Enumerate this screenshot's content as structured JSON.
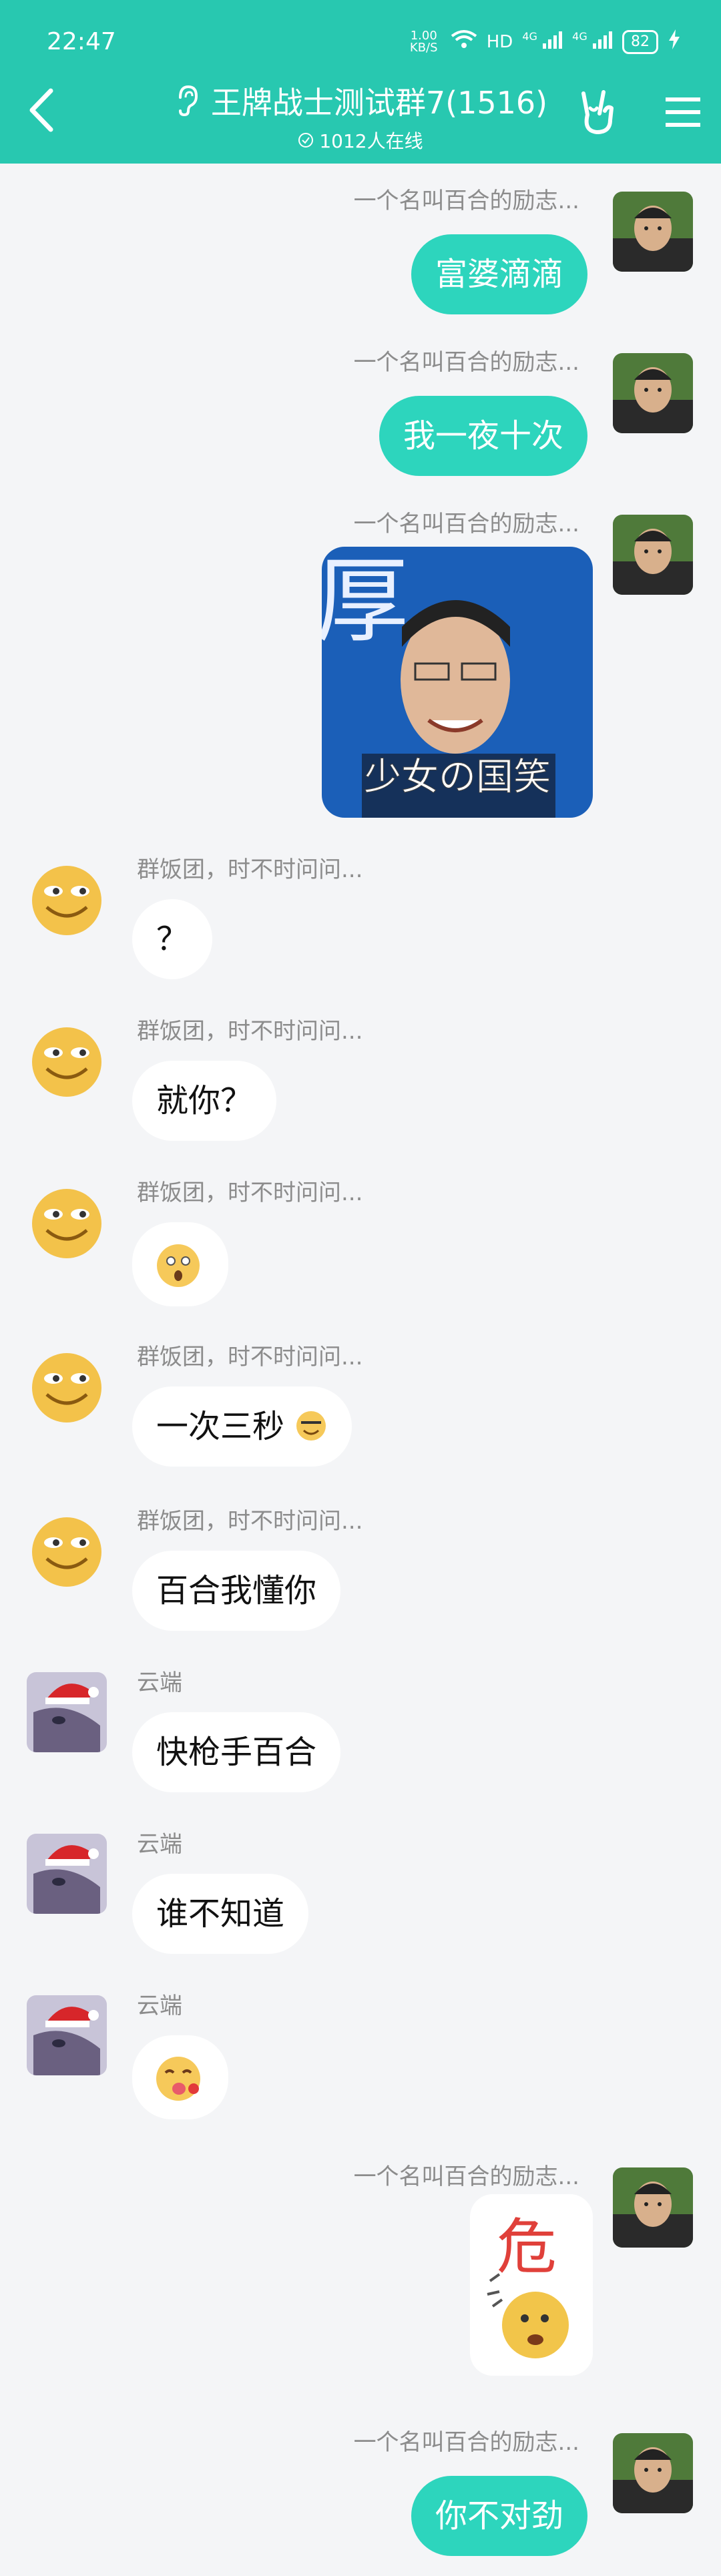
{
  "status_bar": {
    "time": "22:47",
    "network_speed": "1.00 KB/S",
    "hd": "HD",
    "signal1": "4G",
    "signal2": "4G",
    "battery": "82"
  },
  "header": {
    "title": "王牌战士测试群7(1516)",
    "online": "1012人在线"
  },
  "messages": [
    {
      "sender": "一个名叫百合的励志...",
      "side": "right",
      "text": "富婆滴滴"
    },
    {
      "sender": "一个名叫百合的励志...",
      "side": "right",
      "text": "我一夜十次"
    },
    {
      "sender": "一个名叫百合的励志...",
      "side": "right",
      "image_caption": "少女の国笑"
    },
    {
      "sender": "群饭团，时不时问问...",
      "side": "left",
      "text": "？"
    },
    {
      "sender": "群饭团，时不时问问...",
      "side": "left",
      "text": "就你？"
    },
    {
      "sender": "群饭团，时不时问问...",
      "side": "left",
      "emoji": "stunned-emoji"
    },
    {
      "sender": "群饭团，时不时问问...",
      "side": "left",
      "text": "一次三秒"
    },
    {
      "sender": "群饭团，时不时问问...",
      "side": "left",
      "text": "百合我懂你"
    },
    {
      "sender": "云端",
      "side": "left",
      "text": "快枪手百合"
    },
    {
      "sender": "云端",
      "side": "left",
      "text": "谁不知道"
    },
    {
      "sender": "云端",
      "side": "left",
      "emoji": "tongue-emoji"
    },
    {
      "sender": "一个名叫百合的励志...",
      "side": "right",
      "sticker": "danger-sticker"
    },
    {
      "sender": "一个名叫百合的励志...",
      "side": "right",
      "text": "你不对劲"
    }
  ],
  "colors": {
    "header": "#28c8b0",
    "bubble_right": "#2dd5bd",
    "bubble_left": "#ffffff",
    "background": "#f4f5f7"
  }
}
